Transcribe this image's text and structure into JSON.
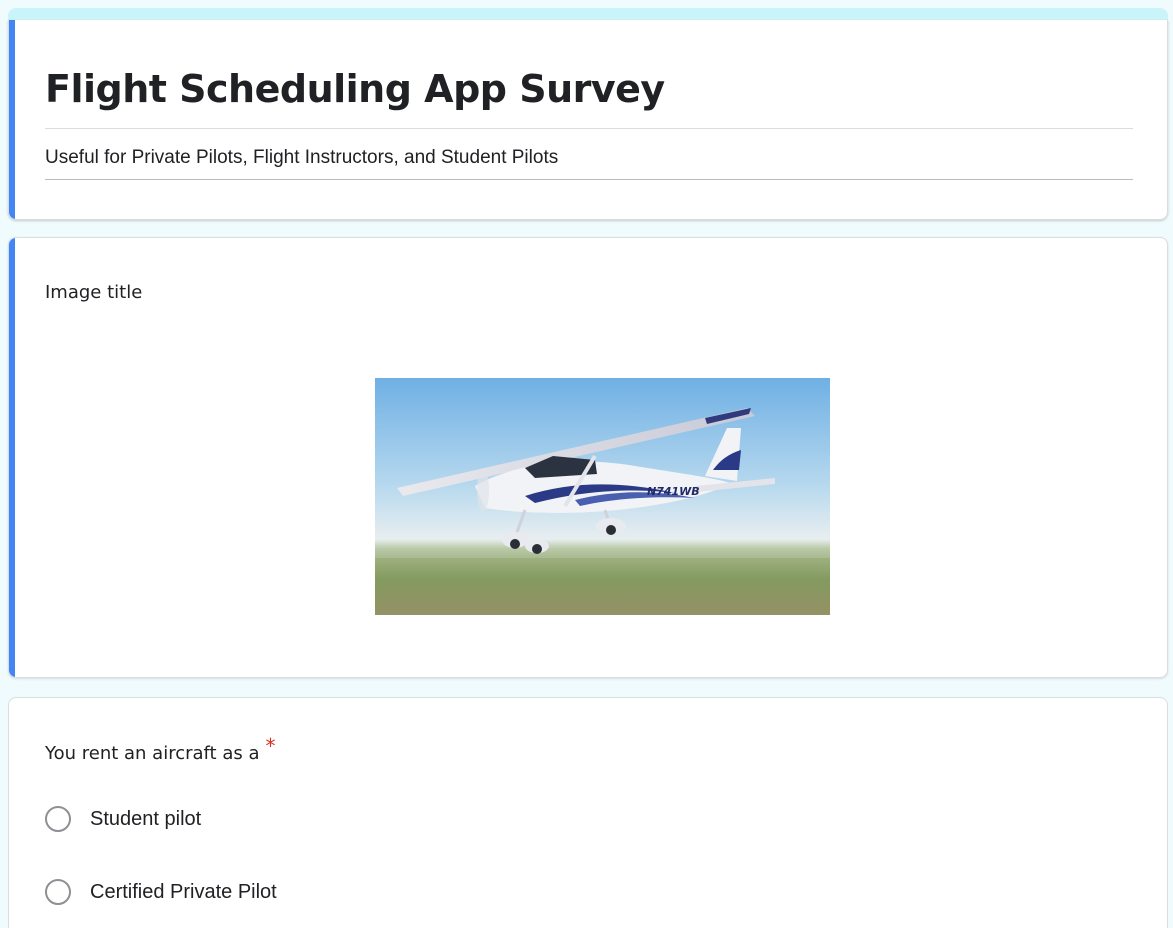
{
  "form": {
    "title": "Flight Scheduling App Survey",
    "description": "Useful for Private Pilots, Flight Instructors, and Student Pilots"
  },
  "image_item": {
    "title": "Image title",
    "plane_registration": "N741WB"
  },
  "question": {
    "title": "You rent an aircraft as a",
    "required_marker": "*",
    "options": [
      {
        "label": "Student pilot"
      },
      {
        "label": "Certified Private Pilot"
      }
    ]
  },
  "colors": {
    "accent": "#4285f4",
    "header_strip": "#c9f4fa",
    "page_background": "#f0fbfd",
    "required": "#d93025"
  }
}
